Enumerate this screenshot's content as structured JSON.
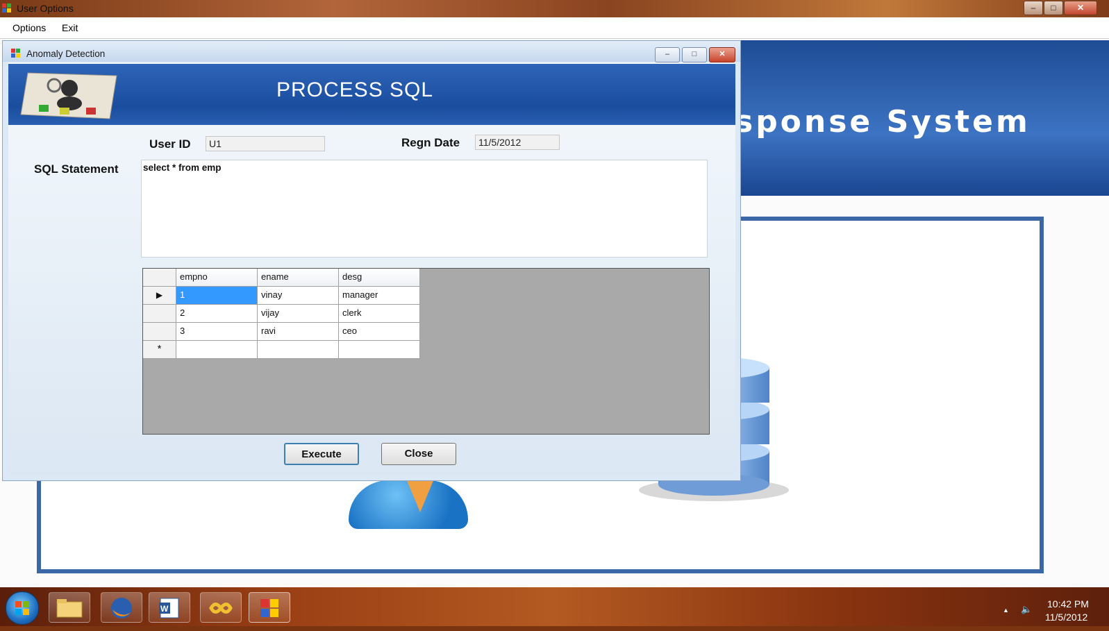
{
  "outer_window": {
    "title": "User Options",
    "minimize": "–",
    "maximize": "□",
    "close": "✕"
  },
  "menu": {
    "items": [
      "Options",
      "Exit"
    ]
  },
  "background_app": {
    "banner_text": "sponse System"
  },
  "dialog": {
    "title": "Anomaly Detection",
    "minimize": "–",
    "maximize": "□",
    "close": "✕",
    "header_title": "PROCESS SQL",
    "user_id_label": "User ID",
    "user_id_value": "U1",
    "regn_date_label": "Regn Date",
    "regn_date_value": "11/5/2012",
    "sql_label": "SQL Statement",
    "sql_value": "select * from emp",
    "grid": {
      "columns": [
        "empno",
        "ename",
        "desg"
      ],
      "rows": [
        [
          "1",
          "vinay",
          "manager"
        ],
        [
          "2",
          "vijay",
          "clerk"
        ],
        [
          "3",
          "ravi",
          "ceo"
        ]
      ],
      "current_row_marker": "▶",
      "new_row_marker": "*"
    },
    "execute_label": "Execute",
    "close_label": "Close"
  },
  "taskbar": {
    "time": "10:42 PM",
    "date": "11/5/2012",
    "tray_up": "▲",
    "volume_icon": "🔈"
  }
}
